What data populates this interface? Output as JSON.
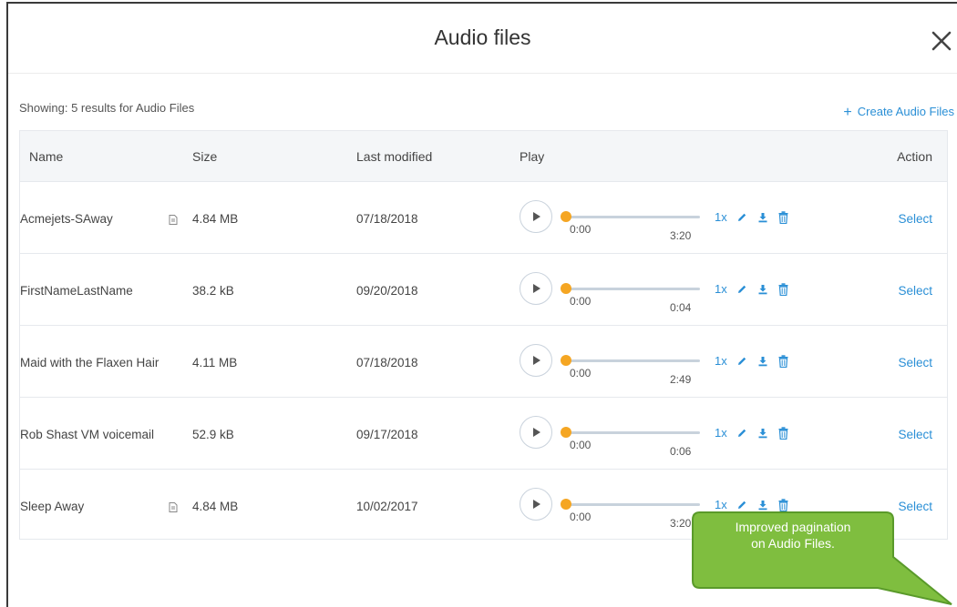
{
  "modal": {
    "title": "Audio files"
  },
  "summary": {
    "showing_text": "Showing: 5 results for Audio Files"
  },
  "actions": {
    "create_label": "Create Audio Files"
  },
  "table": {
    "headers": {
      "name": "Name",
      "size": "Size",
      "last_modified": "Last modified",
      "play": "Play",
      "action": "Action"
    },
    "rows": [
      {
        "name": "Acmejets-SAway",
        "has_doc_icon": true,
        "size": "4.84 MB",
        "modified": "07/18/2018",
        "start": "0:00",
        "end": "3:20",
        "speed": "1x",
        "action": "Select"
      },
      {
        "name": "FirstNameLastName",
        "has_doc_icon": false,
        "size": "38.2 kB",
        "modified": "09/20/2018",
        "start": "0:00",
        "end": "0:04",
        "speed": "1x",
        "action": "Select"
      },
      {
        "name": "Maid with the Flaxen Hair",
        "has_doc_icon": false,
        "size": "4.11 MB",
        "modified": "07/18/2018",
        "start": "0:00",
        "end": "2:49",
        "speed": "1x",
        "action": "Select"
      },
      {
        "name": "Rob Shast VM voicemail",
        "has_doc_icon": false,
        "size": "52.9 kB",
        "modified": "09/17/2018",
        "start": "0:00",
        "end": "0:06",
        "speed": "1x",
        "action": "Select"
      },
      {
        "name": "Sleep Away",
        "has_doc_icon": true,
        "size": "4.84 MB",
        "modified": "10/02/2017",
        "start": "0:00",
        "end": "3:20",
        "speed": "1x",
        "action": "Select"
      }
    ]
  },
  "callout": {
    "text_line1": "Improved pagination",
    "text_line2": "on Audio Files."
  },
  "colors": {
    "link": "#2a8fd6",
    "progress_knob": "#f5a623",
    "callout_fill": "#7fbe3f",
    "callout_border": "#5a9a2a"
  },
  "icons": [
    "close-icon",
    "plus-icon",
    "doc-icon",
    "play-icon",
    "pencil-icon",
    "download-icon",
    "trash-icon"
  ]
}
